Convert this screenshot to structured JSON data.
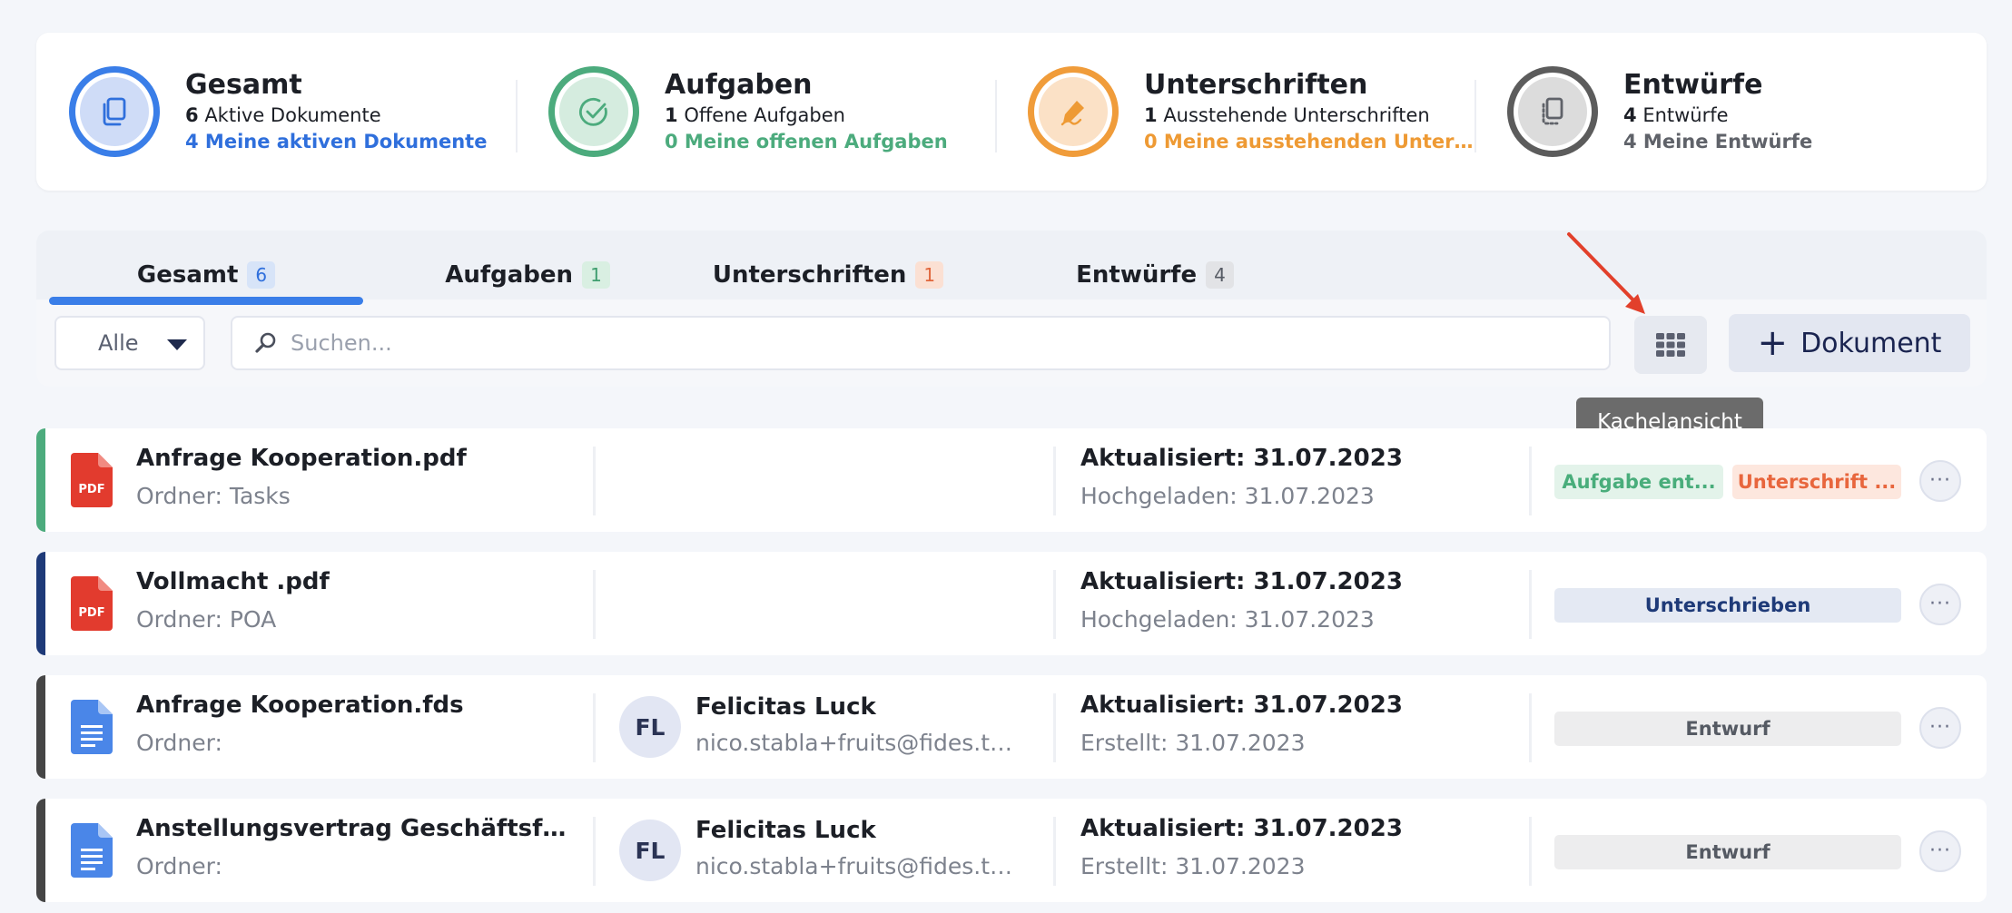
{
  "stats": [
    {
      "title": "Gesamt",
      "count": "6",
      "line1": "Aktive Dokumente",
      "line2": "4 Meine aktiven Dokumente",
      "ring": "#3a7ee8",
      "inner": "#cfdcf7",
      "accent": "#2f6fdc",
      "icon": "documents-icon"
    },
    {
      "title": "Aufgaben",
      "count": "1",
      "line1": "Offene Aufgaben",
      "line2": "0 Meine offenen Aufgaben",
      "ring": "#4cab7d",
      "inner": "#d5ecdf",
      "accent": "#4cab7d",
      "icon": "check-circle-icon"
    },
    {
      "title": "Unterschriften",
      "count": "1",
      "line1": "Ausstehende Unterschriften",
      "line2": "0 Meine ausstehenden Unters...",
      "ring": "#f09c3a",
      "inner": "#fbe1c6",
      "accent": "#ee9a34",
      "icon": "signature-pen-icon"
    },
    {
      "title": "Entwürfe",
      "count": "4",
      "line1": "Entwürfe",
      "line2": "4 Meine Entwürfe",
      "ring": "#5c5c5c",
      "inner": "#dcdcdc",
      "accent": "#5f6269",
      "icon": "draft-icon"
    }
  ],
  "tabs": [
    {
      "label": "Gesamt",
      "count": "6",
      "active": true,
      "countBg": "#d7e4f8",
      "countColor": "#2f6fdc"
    },
    {
      "label": "Aufgaben",
      "count": "1",
      "active": false,
      "countBg": "#d9efe2",
      "countColor": "#3f9e6f"
    },
    {
      "label": "Unterschriften",
      "count": "1",
      "active": false,
      "countBg": "#fbe0d3",
      "countColor": "#e0663c"
    },
    {
      "label": "Entwürfe",
      "count": "4",
      "active": false,
      "countBg": "#e2e3e6",
      "countColor": "#555a63"
    }
  ],
  "toolbar": {
    "filter_label": "Alle",
    "search_placeholder": "Suchen...",
    "new_doc_label": "Dokument",
    "tooltip": "Kachelansicht"
  },
  "documents": [
    {
      "name": "Anfrage Kooperation.pdf",
      "folder": "Ordner: Tasks",
      "type": "pdf",
      "accent": "#4cab7d",
      "person": null,
      "updated": "Aktualisiert: 31.07.2023",
      "secondary": "Hochgeladen: 31.07.2023",
      "badges": [
        {
          "label": "Aufgabe ent...",
          "bg": "#e3f3ea",
          "color": "#49ad7b"
        },
        {
          "label": "Unterschrift ...",
          "bg": "#fde7de",
          "color": "#e8663d"
        }
      ]
    },
    {
      "name": "Vollmacht .pdf",
      "folder": "Ordner: POA",
      "type": "pdf",
      "accent": "#1e3a78",
      "person": null,
      "updated": "Aktualisiert: 31.07.2023",
      "secondary": "Hochgeladen: 31.07.2023",
      "badges": [
        {
          "label": "Unterschrieben",
          "bg": "#e4e9f3",
          "color": "#1e3a78"
        }
      ]
    },
    {
      "name": "Anfrage Kooperation.fds",
      "folder": "Ordner:",
      "type": "doc",
      "accent": "#454545",
      "person": {
        "initials": "FL",
        "name": "Felicitas Luck",
        "email": "nico.stabla+fruits@fides.te..."
      },
      "updated": "Aktualisiert: 31.07.2023",
      "secondary": "Erstellt: 31.07.2023",
      "badges": [
        {
          "label": "Entwurf",
          "bg": "#ededee",
          "color": "#555a63"
        }
      ]
    },
    {
      "name": "Anstellungsvertrag Geschäftsfüh...",
      "folder": "Ordner:",
      "type": "doc",
      "accent": "#454545",
      "person": {
        "initials": "FL",
        "name": "Felicitas Luck",
        "email": "nico.stabla+fruits@fides.te..."
      },
      "updated": "Aktualisiert: 31.07.2023",
      "secondary": "Erstellt: 31.07.2023",
      "badges": [
        {
          "label": "Entwurf",
          "bg": "#ededee",
          "color": "#555a63"
        }
      ]
    }
  ],
  "icons": {
    "pdf_label": "PDF",
    "pdf_color": "#e23b2e",
    "doc_color": "#4a86e8",
    "more": "···"
  }
}
